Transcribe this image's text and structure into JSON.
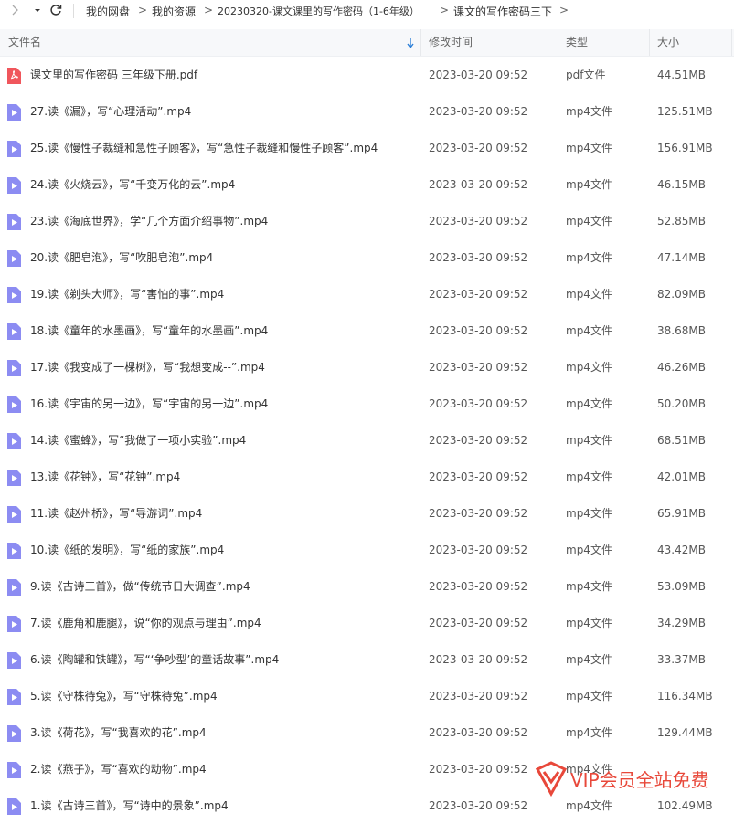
{
  "breadcrumb": {
    "items": [
      "我的网盘",
      "我的资源",
      "20230320-课文课里的写作密码（1-6年级）",
      "课文的写作密码三下"
    ]
  },
  "columns": {
    "name": "文件名",
    "modified": "修改时间",
    "type": "类型",
    "size": "大小"
  },
  "files": [
    {
      "name": "课文里的写作密码 三年级下册.pdf",
      "modified": "2023-03-20 09:52",
      "type": "pdf文件",
      "size": "44.51MB",
      "icon": "pdf-icon"
    },
    {
      "name": "27.读《漏》，写“心理活动”.mp4",
      "modified": "2023-03-20 09:52",
      "type": "mp4文件",
      "size": "125.51MB",
      "icon": "video-icon"
    },
    {
      "name": "25.读《慢性子裁缝和急性子顾客》，写“急性子裁缝和慢性子顾客”.mp4",
      "modified": "2023-03-20 09:52",
      "type": "mp4文件",
      "size": "156.91MB",
      "icon": "video-icon"
    },
    {
      "name": "24.读《火烧云》，写“千变万化的云”.mp4",
      "modified": "2023-03-20 09:52",
      "type": "mp4文件",
      "size": "46.15MB",
      "icon": "video-icon"
    },
    {
      "name": "23.读《海底世界》，学“几个方面介绍事物”.mp4",
      "modified": "2023-03-20 09:52",
      "type": "mp4文件",
      "size": "52.85MB",
      "icon": "video-icon"
    },
    {
      "name": "20.读《肥皂泡》，写“吹肥皂泡”.mp4",
      "modified": "2023-03-20 09:52",
      "type": "mp4文件",
      "size": "47.14MB",
      "icon": "video-icon"
    },
    {
      "name": "19.读《剃头大师》，写“害怕的事”.mp4",
      "modified": "2023-03-20 09:52",
      "type": "mp4文件",
      "size": "82.09MB",
      "icon": "video-icon"
    },
    {
      "name": "18.读《童年的水墨画》，写“童年的水墨画”.mp4",
      "modified": "2023-03-20 09:52",
      "type": "mp4文件",
      "size": "38.68MB",
      "icon": "video-icon"
    },
    {
      "name": "17.读《我变成了一棵树》，写“我想变成--”.mp4",
      "modified": "2023-03-20 09:52",
      "type": "mp4文件",
      "size": "46.26MB",
      "icon": "video-icon"
    },
    {
      "name": "16.读《宇宙的另一边》，写“宇宙的另一边”.mp4",
      "modified": "2023-03-20 09:52",
      "type": "mp4文件",
      "size": "50.20MB",
      "icon": "video-icon"
    },
    {
      "name": "14.读《蜜蜂》，写“我做了一项小实验”.mp4",
      "modified": "2023-03-20 09:52",
      "type": "mp4文件",
      "size": "68.51MB",
      "icon": "video-icon"
    },
    {
      "name": "13.读《花钟》，写“花钟”.mp4",
      "modified": "2023-03-20 09:52",
      "type": "mp4文件",
      "size": "42.01MB",
      "icon": "video-icon"
    },
    {
      "name": "11.读《赵州桥》，写“导游词”.mp4",
      "modified": "2023-03-20 09:52",
      "type": "mp4文件",
      "size": "65.91MB",
      "icon": "video-icon"
    },
    {
      "name": "10.读《纸的发明》，写“纸的家族”.mp4",
      "modified": "2023-03-20 09:52",
      "type": "mp4文件",
      "size": "43.42MB",
      "icon": "video-icon"
    },
    {
      "name": "9.读《古诗三首》，做“传统节日大调查”.mp4",
      "modified": "2023-03-20 09:52",
      "type": "mp4文件",
      "size": "53.09MB",
      "icon": "video-icon"
    },
    {
      "name": "7.读《鹿角和鹿腿》，说“你的观点与理由”.mp4",
      "modified": "2023-03-20 09:52",
      "type": "mp4文件",
      "size": "34.29MB",
      "icon": "video-icon"
    },
    {
      "name": "6.读《陶罐和铁罐》，写“‘争吵型’的童话故事”.mp4",
      "modified": "2023-03-20 09:52",
      "type": "mp4文件",
      "size": "33.37MB",
      "icon": "video-icon"
    },
    {
      "name": "5.读《守株待兔》，写“守株待兔”.mp4",
      "modified": "2023-03-20 09:52",
      "type": "mp4文件",
      "size": "116.34MB",
      "icon": "video-icon"
    },
    {
      "name": "3.读《荷花》，写“我喜欢的花”.mp4",
      "modified": "2023-03-20 09:52",
      "type": "mp4文件",
      "size": "129.44MB",
      "icon": "video-icon"
    },
    {
      "name": "2.读《燕子》，写“喜欢的动物”.mp4",
      "modified": "2023-03-20 09:52",
      "type": "mp4文件",
      "size": "",
      "icon": "video-icon"
    },
    {
      "name": "1.读《古诗三首》，写“诗中的景象”.mp4",
      "modified": "2023-03-20 09:52",
      "type": "mp4文件",
      "size": "102.49MB",
      "icon": "video-icon"
    }
  ],
  "watermark": {
    "text": "VIP会员全站免费"
  },
  "colors": {
    "pdf": "#f0565c",
    "video": "#8c8cf2",
    "accent": "#2b7ed7",
    "watermark": "#e8483a"
  }
}
